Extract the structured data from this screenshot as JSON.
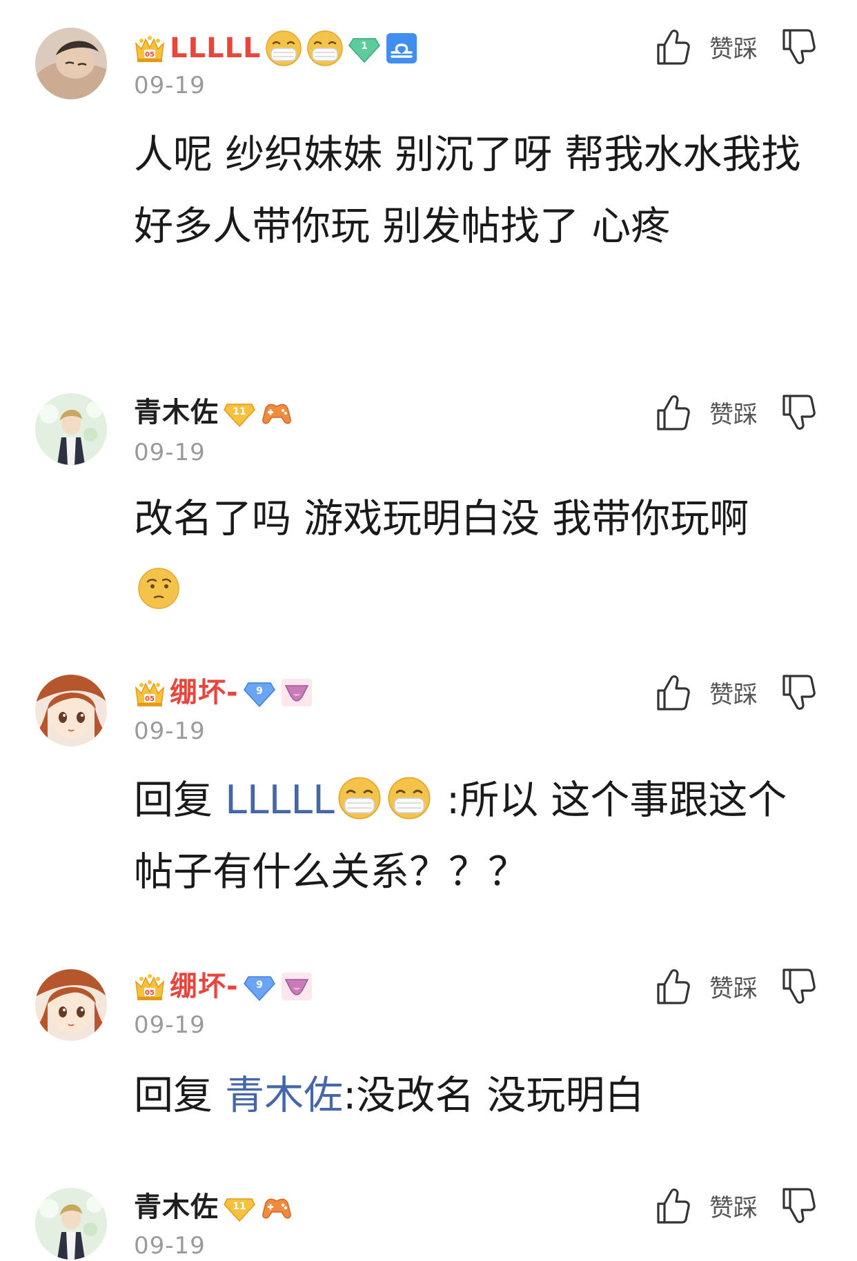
{
  "labels": {
    "like_dislike": "赞踩"
  },
  "comments": [
    {
      "username": "LLLLL",
      "date": "09-19",
      "text": "人呢 纱织妹妹 别沉了呀 帮我水水我找好多人带你玩 别发帖找了 心疼",
      "badges": [
        "crown",
        "mask-emoji",
        "mask-emoji",
        "diamond-1",
        "libra"
      ],
      "badge_numbers": {
        "diamond": "1"
      }
    },
    {
      "username": "青木佐",
      "date": "09-19",
      "text": "改名了吗 游戏玩明白没 我带你玩啊",
      "badges": [
        "diamond-11",
        "game-controller"
      ],
      "badge_numbers": {
        "diamond": "11"
      }
    },
    {
      "username": "绷坏-",
      "date": "09-19",
      "reply_prefix": "回复",
      "reply_to": "LLLLL",
      "text": ":所以 这个事跟这个帖子有什么关系？？？",
      "badges": [
        "crown",
        "diamond-9",
        "underwear"
      ],
      "badge_numbers": {
        "diamond": "9"
      }
    },
    {
      "username": "绷坏-",
      "date": "09-19",
      "reply_prefix": "回复",
      "reply_to": "青木佐",
      "text": ":没改名 没玩明白",
      "badges": [
        "crown",
        "diamond-9",
        "underwear"
      ],
      "badge_numbers": {
        "diamond": "9"
      }
    },
    {
      "username": "青木佐",
      "date": "09-19",
      "badges": [
        "diamond-11",
        "game-controller"
      ],
      "badge_numbers": {
        "diamond": "11"
      }
    }
  ],
  "colors": {
    "vip_name": "#e8453c",
    "reply_link": "#4566a8",
    "date": "#9a9a9a"
  }
}
